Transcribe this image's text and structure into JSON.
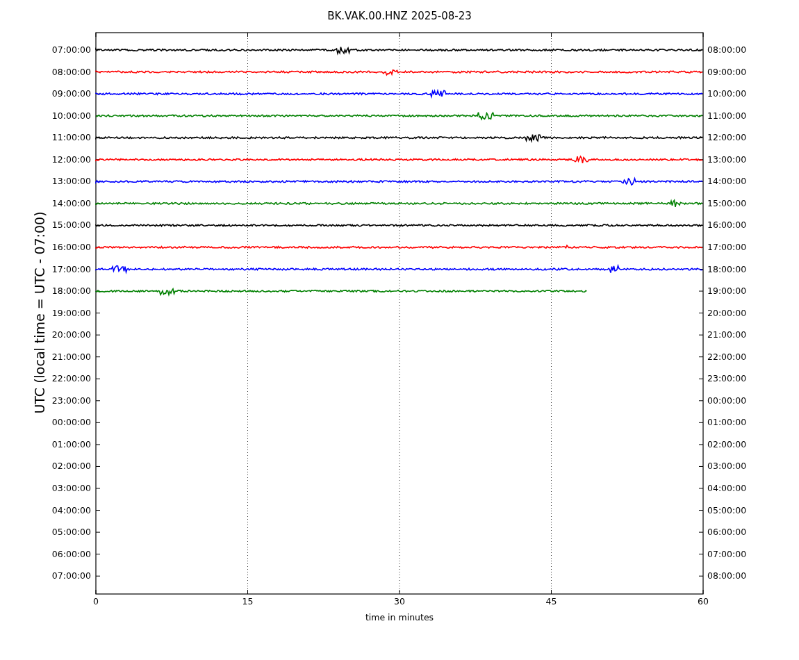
{
  "title": "BK.VAK.00.HNZ 2025-08-23",
  "ylabel": "UTC (local time = UTC - 07:00)",
  "xlabel": "time in minutes",
  "xticks": [
    "0",
    "15",
    "30",
    "45",
    "60"
  ],
  "left_labels": [
    "07:00:00",
    "08:00:00",
    "09:00:00",
    "10:00:00",
    "11:00:00",
    "12:00:00",
    "13:00:00",
    "14:00:00",
    "15:00:00",
    "16:00:00",
    "17:00:00",
    "18:00:00",
    "19:00:00",
    "20:00:00",
    "21:00:00",
    "22:00:00",
    "23:00:00",
    "00:00:00",
    "01:00:00",
    "02:00:00",
    "03:00:00",
    "04:00:00",
    "05:00:00",
    "06:00:00",
    "07:00:00"
  ],
  "right_labels": [
    "08:00:00",
    "09:00:00",
    "10:00:00",
    "11:00:00",
    "12:00:00",
    "13:00:00",
    "14:00:00",
    "15:00:00",
    "16:00:00",
    "17:00:00",
    "18:00:00",
    "19:00:00",
    "20:00:00",
    "21:00:00",
    "22:00:00",
    "23:00:00",
    "00:00:00",
    "01:00:00",
    "02:00:00",
    "03:00:00",
    "04:00:00",
    "05:00:00",
    "06:00:00",
    "07:00:00",
    "08:00:00"
  ],
  "traces": [
    {
      "color": "#000000",
      "level": 1
    },
    {
      "color": "#ff0000",
      "level": 1
    },
    {
      "color": "#0000ff",
      "level": 1
    },
    {
      "color": "#008000",
      "level": 1
    },
    {
      "color": "#000000",
      "level": 1
    },
    {
      "color": "#ff0000",
      "level": 1
    },
    {
      "color": "#0000ff",
      "level": 1
    },
    {
      "color": "#008000",
      "level": 1
    },
    {
      "color": "#000000",
      "level": 1
    },
    {
      "color": "#ff0000",
      "level": 1
    },
    {
      "color": "#0000ff",
      "level": 1
    },
    {
      "color": "#008000",
      "level": 0.81
    }
  ]
}
